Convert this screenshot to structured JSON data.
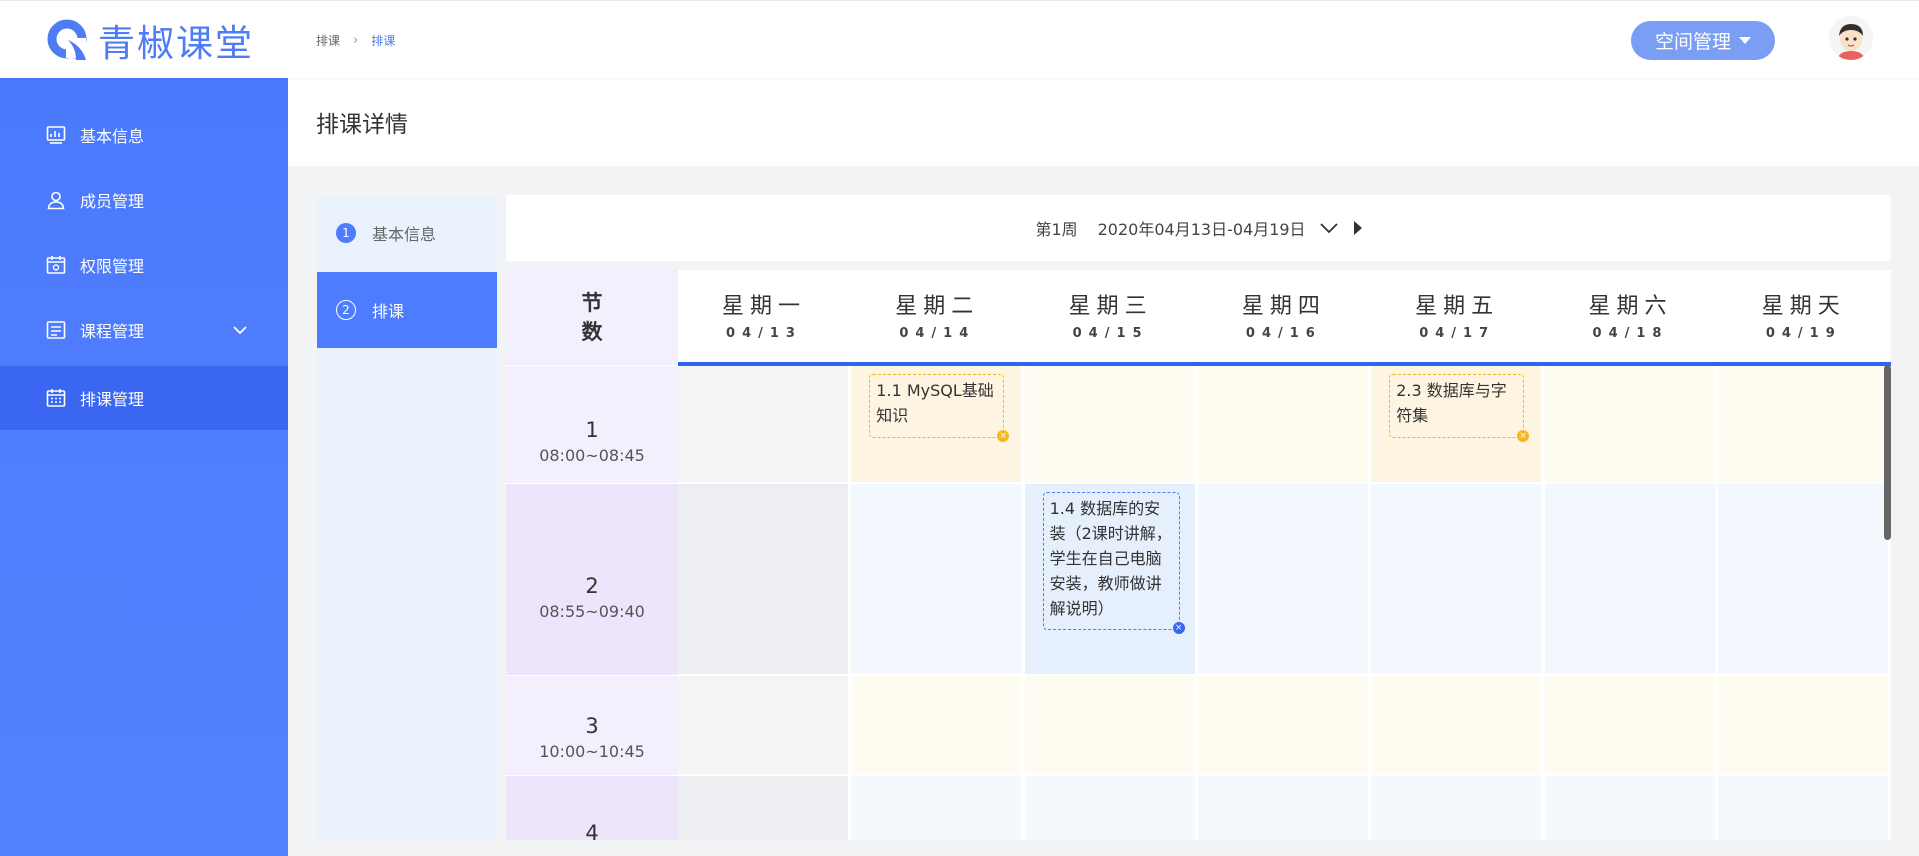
{
  "app": {
    "name": "青椒课堂"
  },
  "breadcrumb": {
    "parent": "排课",
    "current": "排课"
  },
  "header": {
    "space_label": "空间管理"
  },
  "sidebar": {
    "items": [
      {
        "label": "基本信息",
        "icon": "dashboard-icon"
      },
      {
        "label": "成员管理",
        "icon": "user-icon"
      },
      {
        "label": "权限管理",
        "icon": "calendar-check-icon"
      },
      {
        "label": "课程管理",
        "icon": "list-icon"
      },
      {
        "label": "排课管理",
        "icon": "calendar-icon"
      }
    ]
  },
  "page": {
    "title": "排课详情"
  },
  "steps": [
    {
      "num": "1",
      "label": "基本信息"
    },
    {
      "num": "2",
      "label": "排课"
    }
  ],
  "week": {
    "label": "第1周",
    "range": "2020年04月13日-04月19日"
  },
  "grid": {
    "corner": [
      "节",
      "数"
    ],
    "days": [
      {
        "name": "星期一",
        "date": "04/13"
      },
      {
        "name": "星期二",
        "date": "04/14"
      },
      {
        "name": "星期三",
        "date": "04/15"
      },
      {
        "name": "星期四",
        "date": "04/16"
      },
      {
        "name": "星期五",
        "date": "04/17"
      },
      {
        "name": "星期六",
        "date": "04/18"
      },
      {
        "name": "星期天",
        "date": "04/19"
      }
    ],
    "periods": [
      {
        "num": "1",
        "time": "08:00~08:45"
      },
      {
        "num": "2",
        "time": "08:55~09:40"
      },
      {
        "num": "3",
        "time": "10:00~10:45"
      },
      {
        "num": "4",
        "time": ""
      }
    ],
    "courses": [
      {
        "title": "1.1 MySQL基础知识",
        "day": "星期二",
        "period": "1"
      },
      {
        "title": "2.3 数据库与字符集",
        "day": "星期五",
        "period": "1"
      },
      {
        "title": "1.4 数据库的安装（2课时讲解，学生在自己电脑安装，教师做讲解说明）",
        "day": "星期三",
        "period": "2"
      }
    ]
  },
  "colors": {
    "primary": "#4d7cfe",
    "accent_yellow": "#f0b722"
  }
}
